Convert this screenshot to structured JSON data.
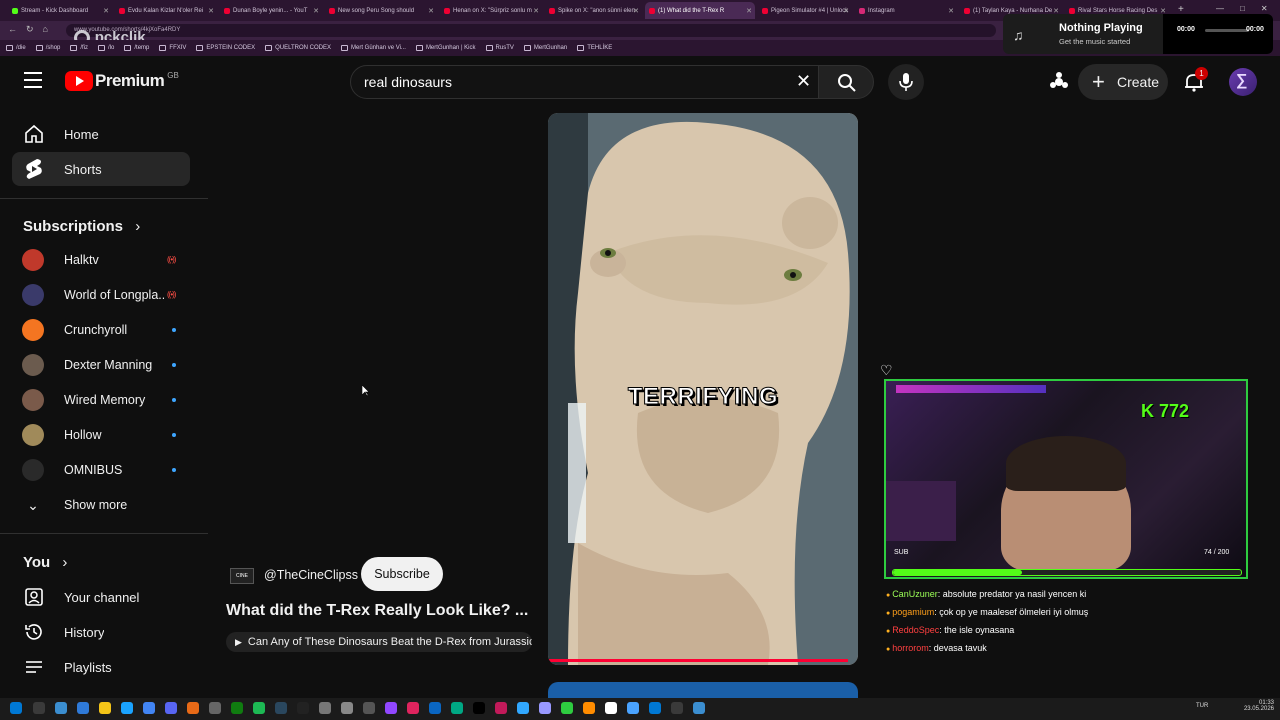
{
  "browser": {
    "tabs": [
      {
        "label": "Stream - Kick Dashboard"
      },
      {
        "label": "Evdu Kalan Kizlar N'oler Rei"
      },
      {
        "label": "Dunan Boyle yenin... - YouT"
      },
      {
        "label": "New song Peru Song should"
      },
      {
        "label": "Henan on X: \"Sürpriz sonlu m"
      },
      {
        "label": "Spike on X: \"anon sünni elen"
      },
      {
        "label": "(1) What did the T-Rex R"
      },
      {
        "label": "Pigeon Simulator #4 | Unlock"
      },
      {
        "label": "Instagram"
      },
      {
        "label": "(1) Taylan Kaya - Nurhana De"
      },
      {
        "label": "Rival Stars Horse Racing Des"
      }
    ],
    "url": "www.youtube.com/shorts/4kjXoFa4RDY",
    "bookmarks": [
      "/die",
      "/shop",
      "/fiz",
      "/lo",
      "/temp",
      "FFXIV",
      "EPSTEIN CODEX",
      "QUELTRON CODEX",
      "Mert Günhan ve Vi...",
      "MertGunhan | Kick",
      "RusTV",
      "MertGunhan",
      "TEHLİKE"
    ],
    "watermark": "pckclik"
  },
  "music_widget": {
    "title": "Nothing Playing",
    "subtitle": "Get the music started",
    "time_start": "00:00",
    "time_end": "00:00"
  },
  "header": {
    "logo_text": "Premium",
    "region": "GB",
    "search_value": "real dinosaurs",
    "create_label": "Create",
    "notification_count": "1"
  },
  "sidebar": {
    "items": [
      {
        "label": "Home"
      },
      {
        "label": "Shorts"
      }
    ],
    "subscriptions_title": "Subscriptions",
    "subscriptions": [
      {
        "label": "Halktv",
        "avatar_color": "#c0392b",
        "status": "live"
      },
      {
        "label": "World of Longpla...",
        "avatar_color": "#3a3a6a",
        "status": "live"
      },
      {
        "label": "Crunchyroll",
        "avatar_color": "#f47521",
        "status": "new"
      },
      {
        "label": "Dexter Manning",
        "avatar_color": "#6b5b4e",
        "status": "new"
      },
      {
        "label": "Wired Memory",
        "avatar_color": "#7a5a4a",
        "status": "new"
      },
      {
        "label": "Hollow",
        "avatar_color": "#a08a5a",
        "status": "new"
      },
      {
        "label": "OMNIBUS",
        "avatar_color": "#2a2a2a",
        "status": "new"
      }
    ],
    "show_more": "Show more",
    "you_title": "You",
    "you_items": [
      {
        "label": "Your channel"
      },
      {
        "label": "History"
      },
      {
        "label": "Playlists"
      }
    ]
  },
  "short": {
    "channel": "@TheCineClipss",
    "subscribe_label": "Subscribe",
    "title": "What did the T-Rex Really Look Like? ...",
    "related": "Can Any of These Dinosaurs Beat the D-Rex from Jurassic...",
    "caption": "TERRIFYING"
  },
  "stream_overlay": {
    "counter": "K 772",
    "sub_label": "SUB",
    "sub_count": "74 / 200",
    "sub_progress": 0.37,
    "chat": [
      {
        "user": "CanUzuner",
        "user_color": "#9cff57",
        "text": ": absolute predator ya nasil yencen ki"
      },
      {
        "user": "pogamium",
        "user_color": "#ff9f1a",
        "text": ": çok op ye maalesef ölmeleri iyi olmuş"
      },
      {
        "user": "ReddoSpec",
        "user_color": "#ff4040",
        "text": ": the isle oynasana"
      },
      {
        "user": "horrorom",
        "user_color": "#ff4040",
        "text": ": devasa tavuk"
      }
    ]
  },
  "taskbar": {
    "lang": "TUR",
    "time": "01:33",
    "date": "23.05.2026"
  }
}
